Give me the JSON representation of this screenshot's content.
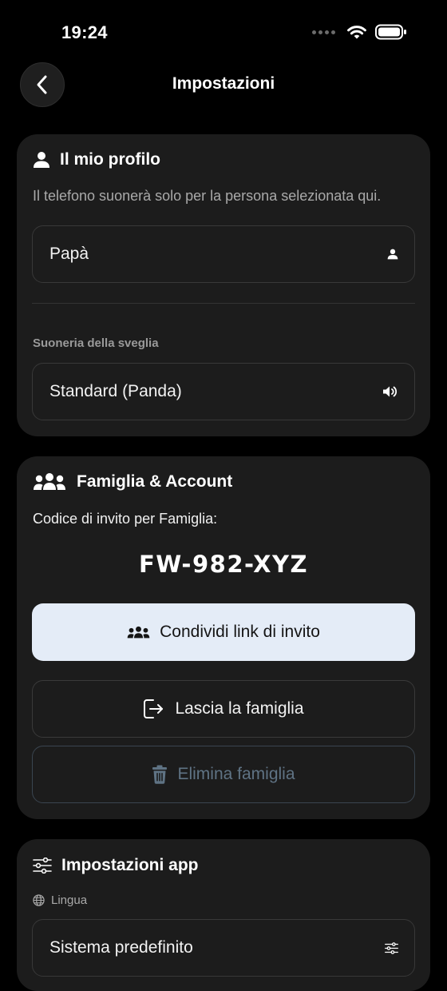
{
  "status_bar": {
    "time": "19:24"
  },
  "nav": {
    "title": "Impostazioni"
  },
  "profile": {
    "title": "Il mio profilo",
    "description": "Il telefono suonerà solo per la persona selezionata qui.",
    "person_value": "Papà",
    "ringtone_label": "Suoneria della sveglia",
    "ringtone_value": "Standard (Panda)"
  },
  "family": {
    "title": "Famiglia & Account",
    "invite_label": "Codice di invito per Famiglia:",
    "invite_code": "FW-982-XYZ",
    "share_label": "Condividi link di invito",
    "leave_label": "Lascia la famiglia",
    "delete_label": "Elimina famiglia"
  },
  "app_settings": {
    "title": "Impostazioni app",
    "language_label": "Lingua",
    "language_value": "Sistema predefinito"
  },
  "colors": {
    "background": "#000000",
    "card": "#1c1c1c",
    "primary_button": "#e4ecf7",
    "danger_text": "#5f7384"
  }
}
